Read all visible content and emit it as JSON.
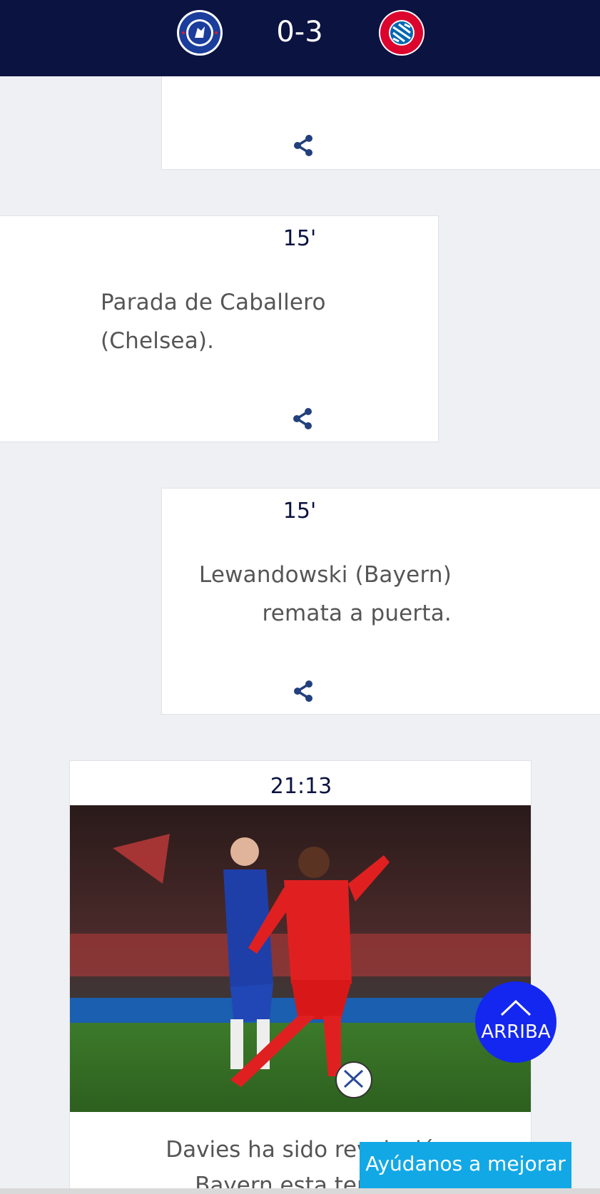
{
  "header": {
    "home_team": "Chelsea",
    "away_team": "Bayern",
    "score": "0-3",
    "home_badge_text": "CHELSEA FOOTBALL CLUB",
    "away_badge_text": "FC BAYERN MÜNCHEN"
  },
  "events": [
    {
      "minute": "15'",
      "text_line1": "Parada de Caballero",
      "text_line2": "(Chelsea)."
    },
    {
      "minute": "15'",
      "text_line1": "Lewandowski (Bayern)",
      "text_line2": "remata a puerta."
    }
  ],
  "media_card": {
    "time": "21:13",
    "caption_line1": "Davies ha sido revelació",
    "caption_line2": "Bayern esta tempo"
  },
  "buttons": {
    "up_label": "ARRIBA",
    "feedback_label": "Ayúdanos a mejorar"
  },
  "colors": {
    "header_bg": "#0b1341",
    "share_icon": "#23407e",
    "up_button": "#1427f0",
    "feedback_button": "#12a8e6",
    "page_bg": "#eef0f3"
  },
  "icons": {
    "share": "share-icon",
    "up": "chevron-up-icon"
  }
}
